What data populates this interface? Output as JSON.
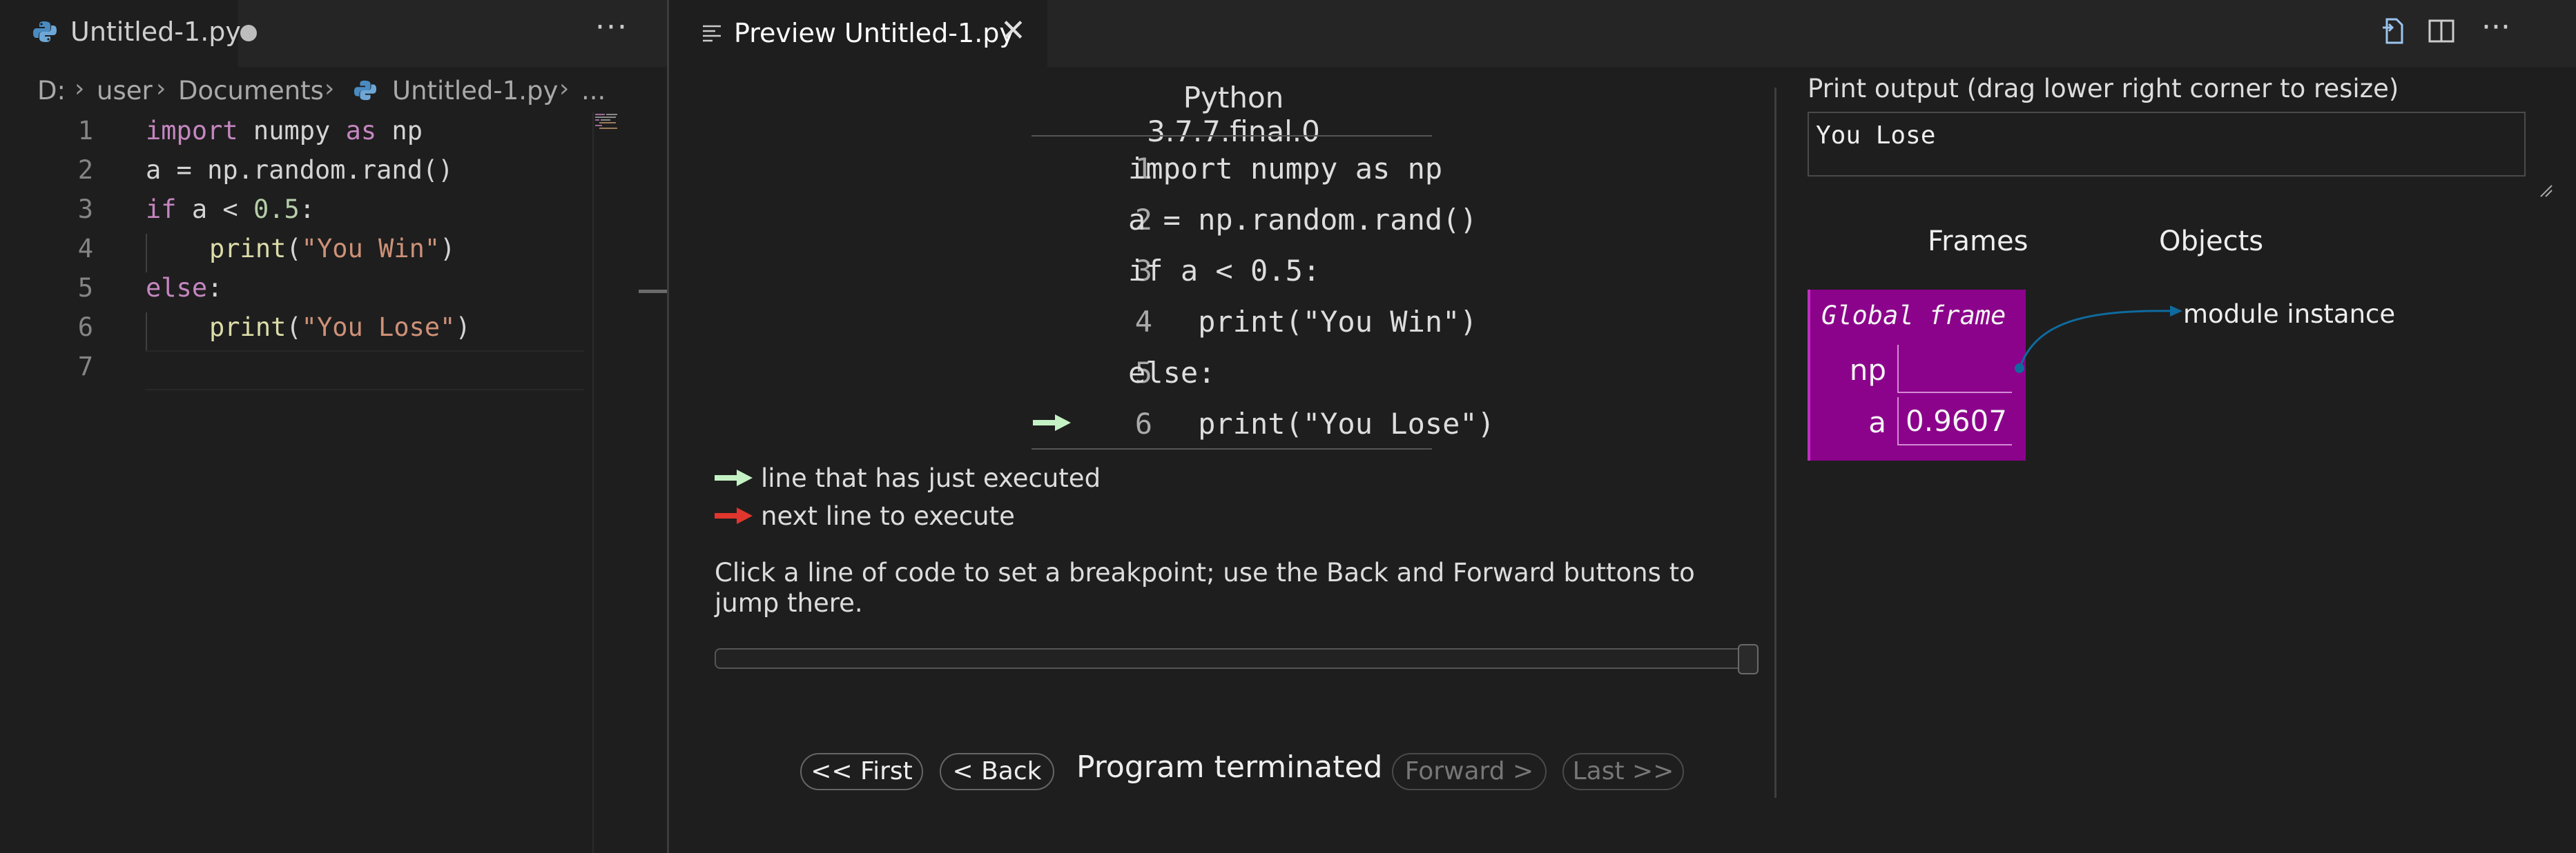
{
  "editor": {
    "tab_label": "Untitled-1.py",
    "more_icon": "ellipsis-icon",
    "breadcrumb": [
      "D:",
      "user",
      "Documents",
      "Untitled-1.py",
      "..."
    ],
    "lines": [
      {
        "n": "1"
      },
      {
        "n": "2"
      },
      {
        "n": "3"
      },
      {
        "n": "4"
      },
      {
        "n": "5"
      },
      {
        "n": "6"
      },
      {
        "n": "7"
      }
    ],
    "tokens": {
      "l1_import": "import",
      "l1_mod": " numpy ",
      "l1_as": "as",
      "l1_np": " np",
      "l2": "a = np.random.rand()",
      "l3_if": "if",
      "l3_mid": " a < ",
      "l3_num": "0.5",
      "l3_end": ":",
      "l4_fn": "print",
      "l4_open": "(",
      "l4_str": "\"You Win\"",
      "l4_close": ")",
      "l5_else": "else",
      "l5_end": ":",
      "l6_fn": "print",
      "l6_open": "(",
      "l6_str": "\"You Lose\"",
      "l6_close": ")"
    }
  },
  "preview": {
    "tab_label": "Preview Untitled-1.py",
    "close_label": "✕",
    "toolbar_icons": [
      "open-source-icon",
      "split-editor-icon",
      "more-actions-icon"
    ]
  },
  "visualizer": {
    "python_version": "Python 3.7.7.final.0",
    "code_lines": [
      {
        "n": "1",
        "text": "import numpy as np"
      },
      {
        "n": "2",
        "text": "a = np.random.rand()"
      },
      {
        "n": "3",
        "text": "if a < 0.5:"
      },
      {
        "n": "4",
        "text": "    print(\"You Win\")"
      },
      {
        "n": "5",
        "text": "else:"
      },
      {
        "n": "6",
        "text": "    print(\"You Lose\")"
      }
    ],
    "current_line": 6,
    "legend": {
      "executed": "line that has just executed",
      "next": "next line to execute",
      "executed_color": "#c5f2c5",
      "next_color": "#e0362d"
    },
    "breakpoint_help": "Click a line of code to set a breakpoint; use the Back and Forward buttons to jump there.",
    "slider_position": 1.0,
    "buttons": {
      "first": "<< First",
      "back": "< Back",
      "forward": "Forward >",
      "last": "Last >>"
    },
    "status": "Program terminated",
    "print_output": {
      "label": "Print output (drag lower right corner to resize)",
      "text": "You Lose"
    },
    "frames_header": "Frames",
    "objects_header": "Objects",
    "global_frame": {
      "title": "Global frame",
      "vars": [
        {
          "name": "np",
          "value": ""
        },
        {
          "name": "a",
          "value": "0.9607"
        }
      ],
      "color": "#8b028b"
    },
    "module_instance": "module instance",
    "pointer_color": "#0e6b9e"
  }
}
